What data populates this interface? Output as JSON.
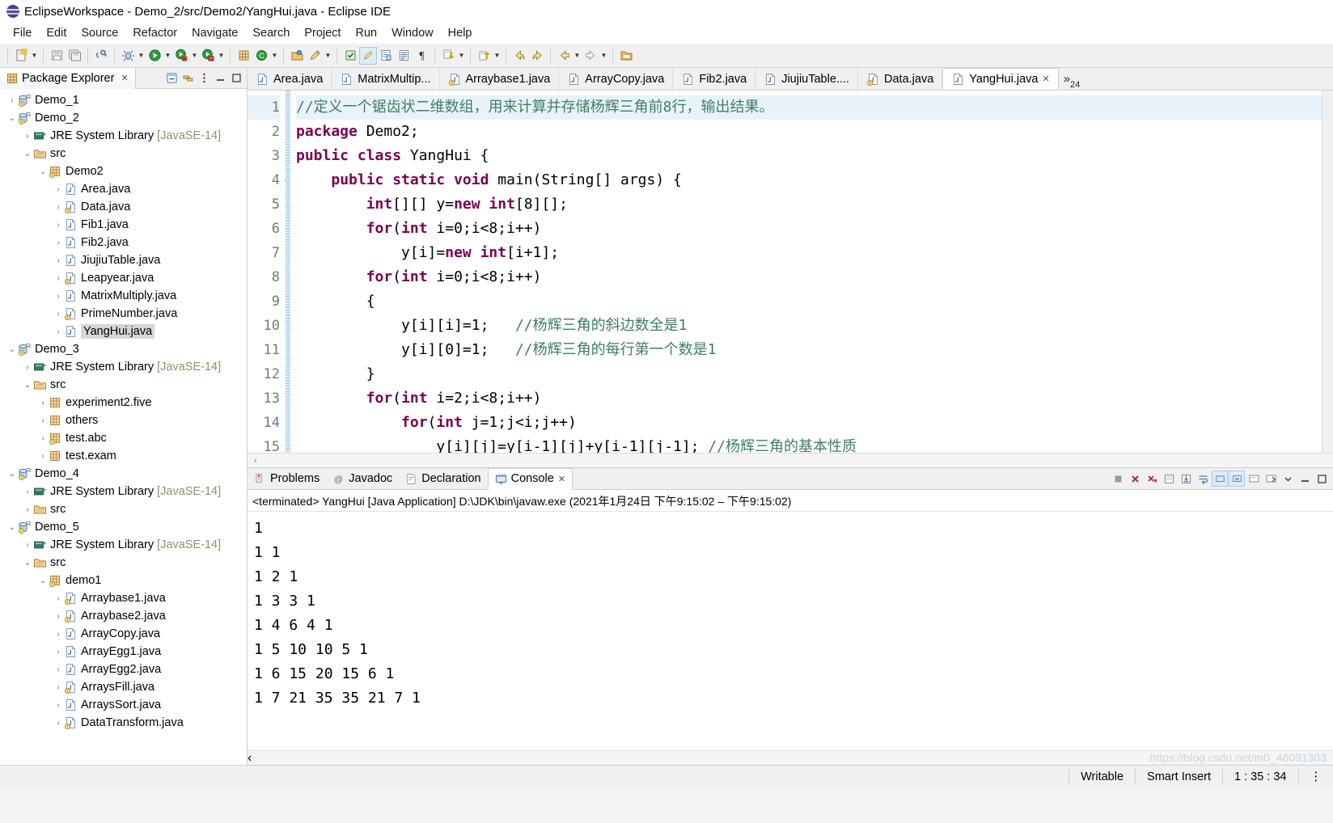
{
  "window": {
    "title": "EclipseWorkspace - Demo_2/src/Demo2/YangHui.java - Eclipse IDE",
    "logo_icon": "eclipse-logo-icon"
  },
  "menubar": {
    "items": [
      "File",
      "Edit",
      "Source",
      "Refactor",
      "Navigate",
      "Search",
      "Project",
      "Run",
      "Window",
      "Help"
    ]
  },
  "toolbar": {
    "groups": [
      {
        "buttons": [
          {
            "icon": "new-wizard-icon",
            "dropdown": true
          },
          {
            "icon": "save-icon",
            "dropdown": false
          },
          {
            "icon": "save-all-icon",
            "dropdown": false
          }
        ]
      },
      {
        "buttons": [
          {
            "icon": "print-icon",
            "dropdown": false
          }
        ]
      },
      {
        "buttons": [
          {
            "icon": "debug-icon",
            "dropdown": true
          },
          {
            "icon": "run-icon",
            "dropdown": true
          },
          {
            "icon": "run-coverage-icon",
            "dropdown": true
          },
          {
            "icon": "external-tools-icon",
            "dropdown": true
          }
        ]
      },
      {
        "buttons": [
          {
            "icon": "new-java-package-icon",
            "dropdown": false
          },
          {
            "icon": "new-java-class-icon",
            "dropdown": true
          }
        ]
      },
      {
        "buttons": [
          {
            "icon": "open-type-icon",
            "dropdown": false
          },
          {
            "icon": "search-icon",
            "dropdown": true
          }
        ]
      },
      {
        "buttons": [
          {
            "icon": "toggle-mark-occurrences-icon",
            "dropdown": false
          },
          {
            "icon": "highlight-pencil-icon",
            "dropdown": false,
            "selected": true
          },
          {
            "icon": "toggle-block-selection-icon",
            "dropdown": false
          },
          {
            "icon": "show-whitespace-icon",
            "dropdown": false
          },
          {
            "icon": "pilcrow-icon",
            "dropdown": false
          }
        ]
      },
      {
        "buttons": [
          {
            "icon": "next-annotation-icon",
            "dropdown": true
          },
          {
            "icon": "previous-annotation-icon",
            "dropdown": true
          }
        ]
      },
      {
        "buttons": [
          {
            "icon": "back-icon",
            "dropdown": false
          },
          {
            "icon": "forward-icon",
            "dropdown": false
          },
          {
            "icon": "previous-edit-icon",
            "dropdown": true
          },
          {
            "icon": "next-edit-icon",
            "dropdown": true
          }
        ]
      },
      {
        "buttons": [
          {
            "icon": "new-folder-icon",
            "dropdown": false
          }
        ]
      }
    ]
  },
  "explorer": {
    "tab_label": "Package Explorer",
    "tab_close_icon": "close-icon",
    "actions": [
      {
        "icon": "collapse-all-icon"
      },
      {
        "icon": "link-with-editor-icon"
      },
      {
        "icon": "view-menu-icon"
      },
      {
        "icon": "minimize-icon"
      },
      {
        "icon": "maximize-icon"
      }
    ],
    "tree": [
      {
        "label": "Demo_1",
        "kind": "project",
        "indent": 0,
        "expanded": false,
        "warn": true
      },
      {
        "label": "Demo_2",
        "kind": "project",
        "indent": 0,
        "expanded": true,
        "warn": true
      },
      {
        "label": "JRE System Library",
        "suffix": "[JavaSE-14]",
        "kind": "library",
        "indent": 1,
        "expanded": false
      },
      {
        "label": "src",
        "kind": "srcfolder",
        "indent": 1,
        "expanded": true
      },
      {
        "label": "Demo2",
        "kind": "package",
        "indent": 2,
        "expanded": true,
        "warn": true
      },
      {
        "label": "Area.java",
        "kind": "java",
        "indent": 3,
        "expanded": false
      },
      {
        "label": "Data.java",
        "kind": "java",
        "indent": 3,
        "expanded": false,
        "warn": true
      },
      {
        "label": "Fib1.java",
        "kind": "java",
        "indent": 3,
        "expanded": false
      },
      {
        "label": "Fib2.java",
        "kind": "java",
        "indent": 3,
        "expanded": false
      },
      {
        "label": "JiujiuTable.java",
        "kind": "java",
        "indent": 3,
        "expanded": false
      },
      {
        "label": "Leapyear.java",
        "kind": "java",
        "indent": 3,
        "expanded": false,
        "warn": true
      },
      {
        "label": "MatrixMultiply.java",
        "kind": "java",
        "indent": 3,
        "expanded": false
      },
      {
        "label": "PrimeNumber.java",
        "kind": "java",
        "indent": 3,
        "expanded": false,
        "warn": true
      },
      {
        "label": "YangHui.java",
        "kind": "java",
        "indent": 3,
        "expanded": false,
        "selected": true
      },
      {
        "label": "Demo_3",
        "kind": "project",
        "indent": 0,
        "expanded": true,
        "warn": true
      },
      {
        "label": "JRE System Library",
        "suffix": "[JavaSE-14]",
        "kind": "library",
        "indent": 1,
        "expanded": false
      },
      {
        "label": "src",
        "kind": "srcfolder",
        "indent": 1,
        "expanded": true
      },
      {
        "label": "experiment2.five",
        "kind": "package",
        "indent": 2,
        "expanded": false
      },
      {
        "label": "others",
        "kind": "package",
        "indent": 2,
        "expanded": false
      },
      {
        "label": "test.abc",
        "kind": "package",
        "indent": 2,
        "expanded": false,
        "warn": true
      },
      {
        "label": "test.exam",
        "kind": "package",
        "indent": 2,
        "expanded": false
      },
      {
        "label": "Demo_4",
        "kind": "project",
        "indent": 0,
        "expanded": true,
        "warn": true
      },
      {
        "label": "JRE System Library",
        "suffix": "[JavaSE-14]",
        "kind": "library",
        "indent": 1,
        "expanded": false
      },
      {
        "label": "src",
        "kind": "srcfolder",
        "indent": 1,
        "expanded": false
      },
      {
        "label": "Demo_5",
        "kind": "project",
        "indent": 0,
        "expanded": true,
        "warn": true
      },
      {
        "label": "JRE System Library",
        "suffix": "[JavaSE-14]",
        "kind": "library",
        "indent": 1,
        "expanded": false
      },
      {
        "label": "src",
        "kind": "srcfolder",
        "indent": 1,
        "expanded": true
      },
      {
        "label": "demo1",
        "kind": "package",
        "indent": 2,
        "expanded": true,
        "warn": true
      },
      {
        "label": "Arraybase1.java",
        "kind": "java",
        "indent": 3,
        "expanded": false,
        "warn": true
      },
      {
        "label": "Arraybase2.java",
        "kind": "java",
        "indent": 3,
        "expanded": false,
        "warn": true
      },
      {
        "label": "ArrayCopy.java",
        "kind": "java",
        "indent": 3,
        "expanded": false
      },
      {
        "label": "ArrayEgg1.java",
        "kind": "java",
        "indent": 3,
        "expanded": false
      },
      {
        "label": "ArrayEgg2.java",
        "kind": "java",
        "indent": 3,
        "expanded": false
      },
      {
        "label": "ArraysFill.java",
        "kind": "java",
        "indent": 3,
        "expanded": false,
        "warn": true
      },
      {
        "label": "ArraysSort.java",
        "kind": "java",
        "indent": 3,
        "expanded": false
      },
      {
        "label": "DataTransform.java",
        "kind": "java",
        "indent": 3,
        "expanded": false,
        "warn": true
      }
    ]
  },
  "editor": {
    "tabs": [
      {
        "label": "Area.java",
        "active": false,
        "warn": false
      },
      {
        "label": "MatrixMultip...",
        "active": false,
        "warn": false
      },
      {
        "label": "Arraybase1.java",
        "active": false,
        "warn": true
      },
      {
        "label": "ArrayCopy.java",
        "active": false,
        "warn": false
      },
      {
        "label": "Fib2.java",
        "active": false,
        "warn": false
      },
      {
        "label": "JiujiuTable....",
        "active": false,
        "warn": false
      },
      {
        "label": "Data.java",
        "active": false,
        "warn": true
      },
      {
        "label": "YangHui.java",
        "active": true,
        "warn": false
      }
    ],
    "overflow_label": "24",
    "overflow_icon": "chevron-double-right-icon",
    "lines": [
      {
        "num": "1",
        "current": true,
        "fold": "",
        "tokens": [
          {
            "t": "//定义一个锯齿状二维数组，用来计算并存储杨辉三角前8行，输出结果。",
            "c": "cm"
          }
        ]
      },
      {
        "num": "2",
        "current": false,
        "fold": "",
        "tokens": [
          {
            "t": "package",
            "c": "kw"
          },
          {
            "t": " Demo2;",
            "c": "lit"
          }
        ]
      },
      {
        "num": "3",
        "current": false,
        "fold": "",
        "tokens": [
          {
            "t": "public class",
            "c": "kw"
          },
          {
            "t": " YangHui {",
            "c": "lit"
          }
        ]
      },
      {
        "num": "4",
        "current": false,
        "fold": "⊖",
        "tokens": [
          {
            "t": "    ",
            "c": "lit"
          },
          {
            "t": "public static void",
            "c": "kw"
          },
          {
            "t": " main(String[] args) {",
            "c": "lit"
          }
        ]
      },
      {
        "num": "5",
        "current": false,
        "fold": "",
        "tokens": [
          {
            "t": "        ",
            "c": "lit"
          },
          {
            "t": "int",
            "c": "kw"
          },
          {
            "t": "[][] y=",
            "c": "lit"
          },
          {
            "t": "new int",
            "c": "kw"
          },
          {
            "t": "[8][];",
            "c": "lit"
          }
        ]
      },
      {
        "num": "6",
        "current": false,
        "fold": "",
        "tokens": [
          {
            "t": "        ",
            "c": "lit"
          },
          {
            "t": "for",
            "c": "kw"
          },
          {
            "t": "(",
            "c": "lit"
          },
          {
            "t": "int",
            "c": "kw"
          },
          {
            "t": " i=0;i<8;i++)",
            "c": "lit"
          }
        ]
      },
      {
        "num": "7",
        "current": false,
        "fold": "",
        "tokens": [
          {
            "t": "            y[i]=",
            "c": "lit"
          },
          {
            "t": "new int",
            "c": "kw"
          },
          {
            "t": "[i+1];",
            "c": "lit"
          }
        ]
      },
      {
        "num": "8",
        "current": false,
        "fold": "",
        "tokens": [
          {
            "t": "        ",
            "c": "lit"
          },
          {
            "t": "for",
            "c": "kw"
          },
          {
            "t": "(",
            "c": "lit"
          },
          {
            "t": "int",
            "c": "kw"
          },
          {
            "t": " i=0;i<8;i++)",
            "c": "lit"
          }
        ]
      },
      {
        "num": "9",
        "current": false,
        "fold": "",
        "tokens": [
          {
            "t": "        {",
            "c": "lit"
          }
        ]
      },
      {
        "num": "10",
        "current": false,
        "fold": "",
        "tokens": [
          {
            "t": "            y[i][i]=1;   ",
            "c": "lit"
          },
          {
            "t": "//杨辉三角的斜边数全是1",
            "c": "cm"
          }
        ]
      },
      {
        "num": "11",
        "current": false,
        "fold": "",
        "tokens": [
          {
            "t": "            y[i][0]=1;   ",
            "c": "lit"
          },
          {
            "t": "//杨辉三角的每行第一个数是1",
            "c": "cm"
          }
        ]
      },
      {
        "num": "12",
        "current": false,
        "fold": "",
        "tokens": [
          {
            "t": "        }",
            "c": "lit"
          }
        ]
      },
      {
        "num": "13",
        "current": false,
        "fold": "",
        "tokens": [
          {
            "t": "        ",
            "c": "lit"
          },
          {
            "t": "for",
            "c": "kw"
          },
          {
            "t": "(",
            "c": "lit"
          },
          {
            "t": "int",
            "c": "kw"
          },
          {
            "t": " i=2;i<8;i++)",
            "c": "lit"
          }
        ]
      },
      {
        "num": "14",
        "current": false,
        "fold": "",
        "tokens": [
          {
            "t": "            ",
            "c": "lit"
          },
          {
            "t": "for",
            "c": "kw"
          },
          {
            "t": "(",
            "c": "lit"
          },
          {
            "t": "int",
            "c": "kw"
          },
          {
            "t": " j=1;j<i;j++)",
            "c": "lit"
          }
        ]
      },
      {
        "num": "15",
        "current": false,
        "fold": "",
        "tokens": [
          {
            "t": "                y[i][j]=y[i-1][j]+y[i-1][j-1]; ",
            "c": "lit"
          },
          {
            "t": "//杨辉三角的基本性质",
            "c": "cm"
          }
        ]
      }
    ]
  },
  "console": {
    "tabs": [
      {
        "label": "Problems",
        "icon": "problems-icon",
        "active": false
      },
      {
        "label": "Javadoc",
        "icon": "javadoc-icon",
        "active": false
      },
      {
        "label": "Declaration",
        "icon": "declaration-icon",
        "active": false
      },
      {
        "label": "Console",
        "icon": "console-icon",
        "active": true,
        "close_icon": "close-icon"
      }
    ],
    "actions": [
      {
        "icon": "terminate-icon"
      },
      {
        "icon": "remove-launch-icon"
      },
      {
        "icon": "remove-all-terminated-icon"
      },
      {
        "icon": "clear-console-icon"
      },
      {
        "icon": "scroll-lock-icon"
      },
      {
        "icon": "word-wrap-icon"
      },
      {
        "icon": "show-console-on-output-icon",
        "selected": true
      },
      {
        "icon": "pin-console-icon",
        "selected": true
      },
      {
        "icon": "display-selected-console-icon"
      },
      {
        "icon": "open-console-icon"
      },
      {
        "icon": "view-menu-icon"
      },
      {
        "icon": "minimize-icon"
      },
      {
        "icon": "maximize-icon"
      }
    ],
    "status_line": "<terminated> YangHui [Java Application] D:\\JDK\\bin\\javaw.exe  (2021年1月24日 下午9:15:02 – 下午9:15:02)",
    "output": [
      "1",
      "1 1",
      "1 2 1",
      "1 3 3 1",
      "1 4 6 4 1",
      "1 5 10 10 5 1",
      "1 6 15 20 15 6 1",
      "1 7 21 35 35 21 7 1"
    ]
  },
  "statusbar": {
    "writable": "Writable",
    "insert_mode": "Smart Insert",
    "cursor_position": "1 : 35 : 34",
    "watermark": "https://blog.csdn.net/m0_46091303"
  },
  "colors": {
    "keyword": "#7b0052",
    "comment": "#3f7f5f",
    "current_line": "#e8f2fb",
    "selection": "#d6d6d6",
    "toolbar_bg": "#f0f0f0"
  }
}
